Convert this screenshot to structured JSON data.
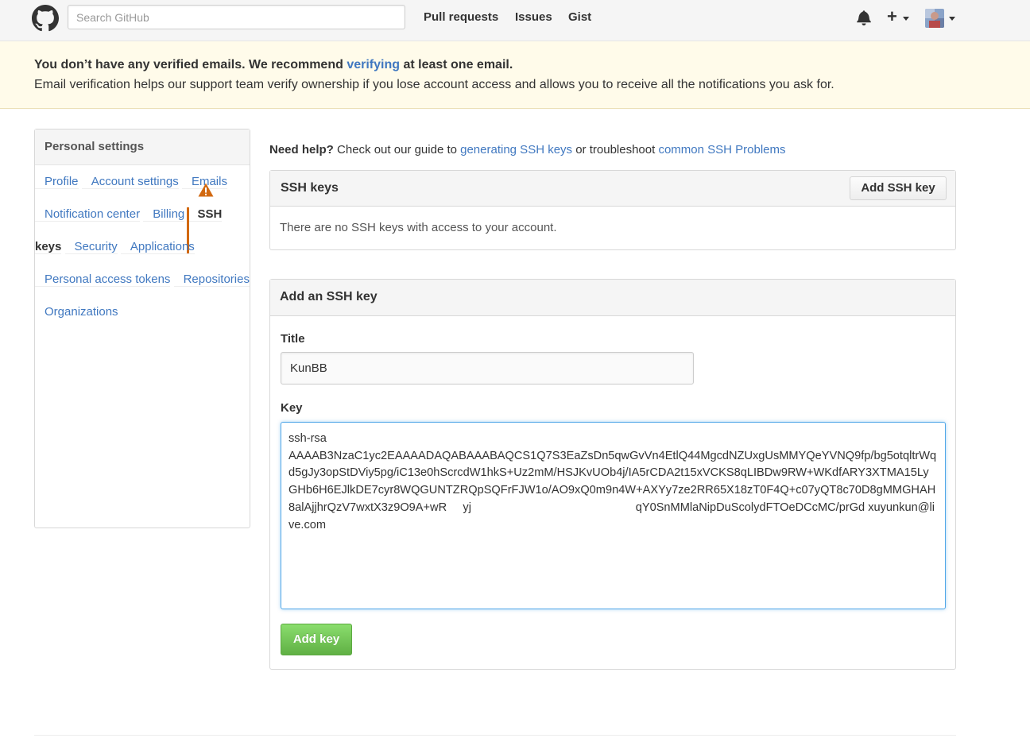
{
  "header": {
    "search_placeholder": "Search GitHub",
    "nav": [
      "Pull requests",
      "Issues",
      "Gist"
    ]
  },
  "flash": {
    "line1_before": "You don’t have any verified emails. We recommend ",
    "line1_link": "verifying",
    "line1_after": " at least one email.",
    "line2": "Email verification helps our support team verify ownership if you lose account access and allows you to receive all the notifications you ask for."
  },
  "sidebar": {
    "heading": "Personal settings",
    "items": [
      {
        "label": "Profile"
      },
      {
        "label": "Account settings"
      },
      {
        "label": "Emails"
      },
      {
        "label": "Notification center"
      },
      {
        "label": "Billing"
      },
      {
        "label": "SSH keys"
      },
      {
        "label": "Security"
      },
      {
        "label": "Applications"
      },
      {
        "label": "Personal access tokens"
      },
      {
        "label": "Repositories"
      },
      {
        "label": "Organizations"
      }
    ],
    "selected_index": 5
  },
  "help": {
    "prefix_bold": "Need help?",
    "text1": " Check out our guide to ",
    "link1": "generating SSH keys",
    "text2": " or troubleshoot ",
    "link2": "common SSH Problems"
  },
  "ssh_keys_box": {
    "title": "SSH keys",
    "add_button": "Add SSH key",
    "empty_text": "There are no SSH keys with access to your account."
  },
  "add_key_form": {
    "title": "Add an SSH key",
    "title_label": "Title",
    "title_value": "KunBB",
    "key_label": "Key",
    "key_value": "ssh-rsa\nAAAAB3NzaC1yc2EAAAADAQABAAABAQCS1Q7S3EaZsDn5qwGvVn4EtlQ44MgcdNZUxgUsMMYQeYVNQ9fp/bg5otqltrWqd5gJy3opStDViy5pg/iC13e0hScrcdW1hkS+Uz2mM/HSJKvUOb4j/IA5rCDA2t15xVCKS8qLIBDw9RW+WKdfARY3XTMA15LyGHb6H6EJlkDE7cyr8WQGUNTZRQpSQFrFJW1o/AO9xQ0m9n4W+AXYy7ze2RR65X18zT0F4Q+c07yQT8c70D8gMMGHAH8alAjjhrQzV7wxtX3z9O9A+wR     yj                                                   qY0SnMMlaNipDuScolydFTOeDCcMC/prGd xuyunkun@live.com",
    "submit_button": "Add key"
  },
  "colors": {
    "link": "#4078c0",
    "accent_selected": "#d26911",
    "warning": "#d26911",
    "primary_button": "#60b044",
    "flash_bg": "#fffbea"
  }
}
